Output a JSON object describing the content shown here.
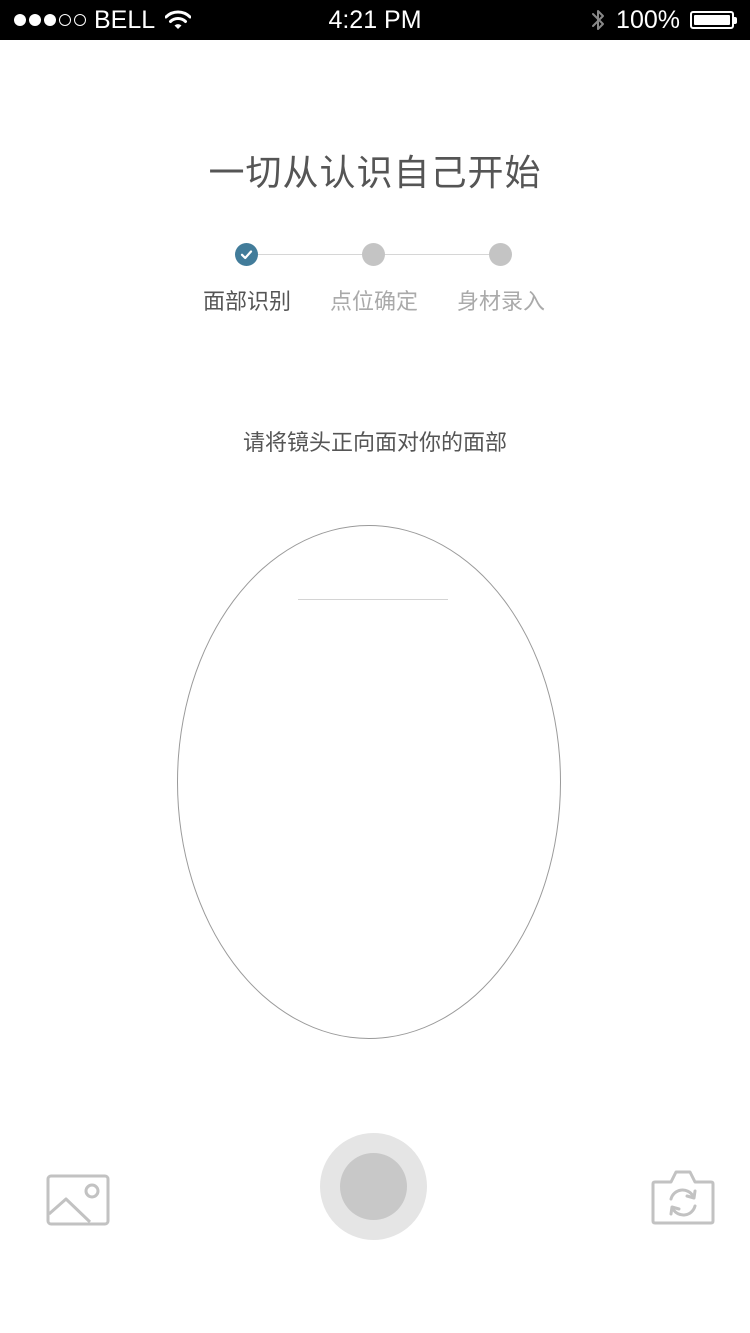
{
  "status_bar": {
    "carrier": "BELL",
    "time": "4:21 PM",
    "battery": "100%",
    "signal_strength": 3,
    "signal_max": 5
  },
  "title": "一切从认识自己开始",
  "steps": [
    {
      "label": "面部识别",
      "state": "done"
    },
    {
      "label": "点位确定",
      "state": "pending"
    },
    {
      "label": "身材录入",
      "state": "pending"
    }
  ],
  "instruction": "请将镜头正向面对你的面部",
  "icons": {
    "gallery": "image-icon",
    "shutter": "shutter-icon",
    "switch_camera": "camera-switch-icon"
  },
  "colors": {
    "accent": "#427c9a",
    "inactive": "#c4c4c4"
  }
}
